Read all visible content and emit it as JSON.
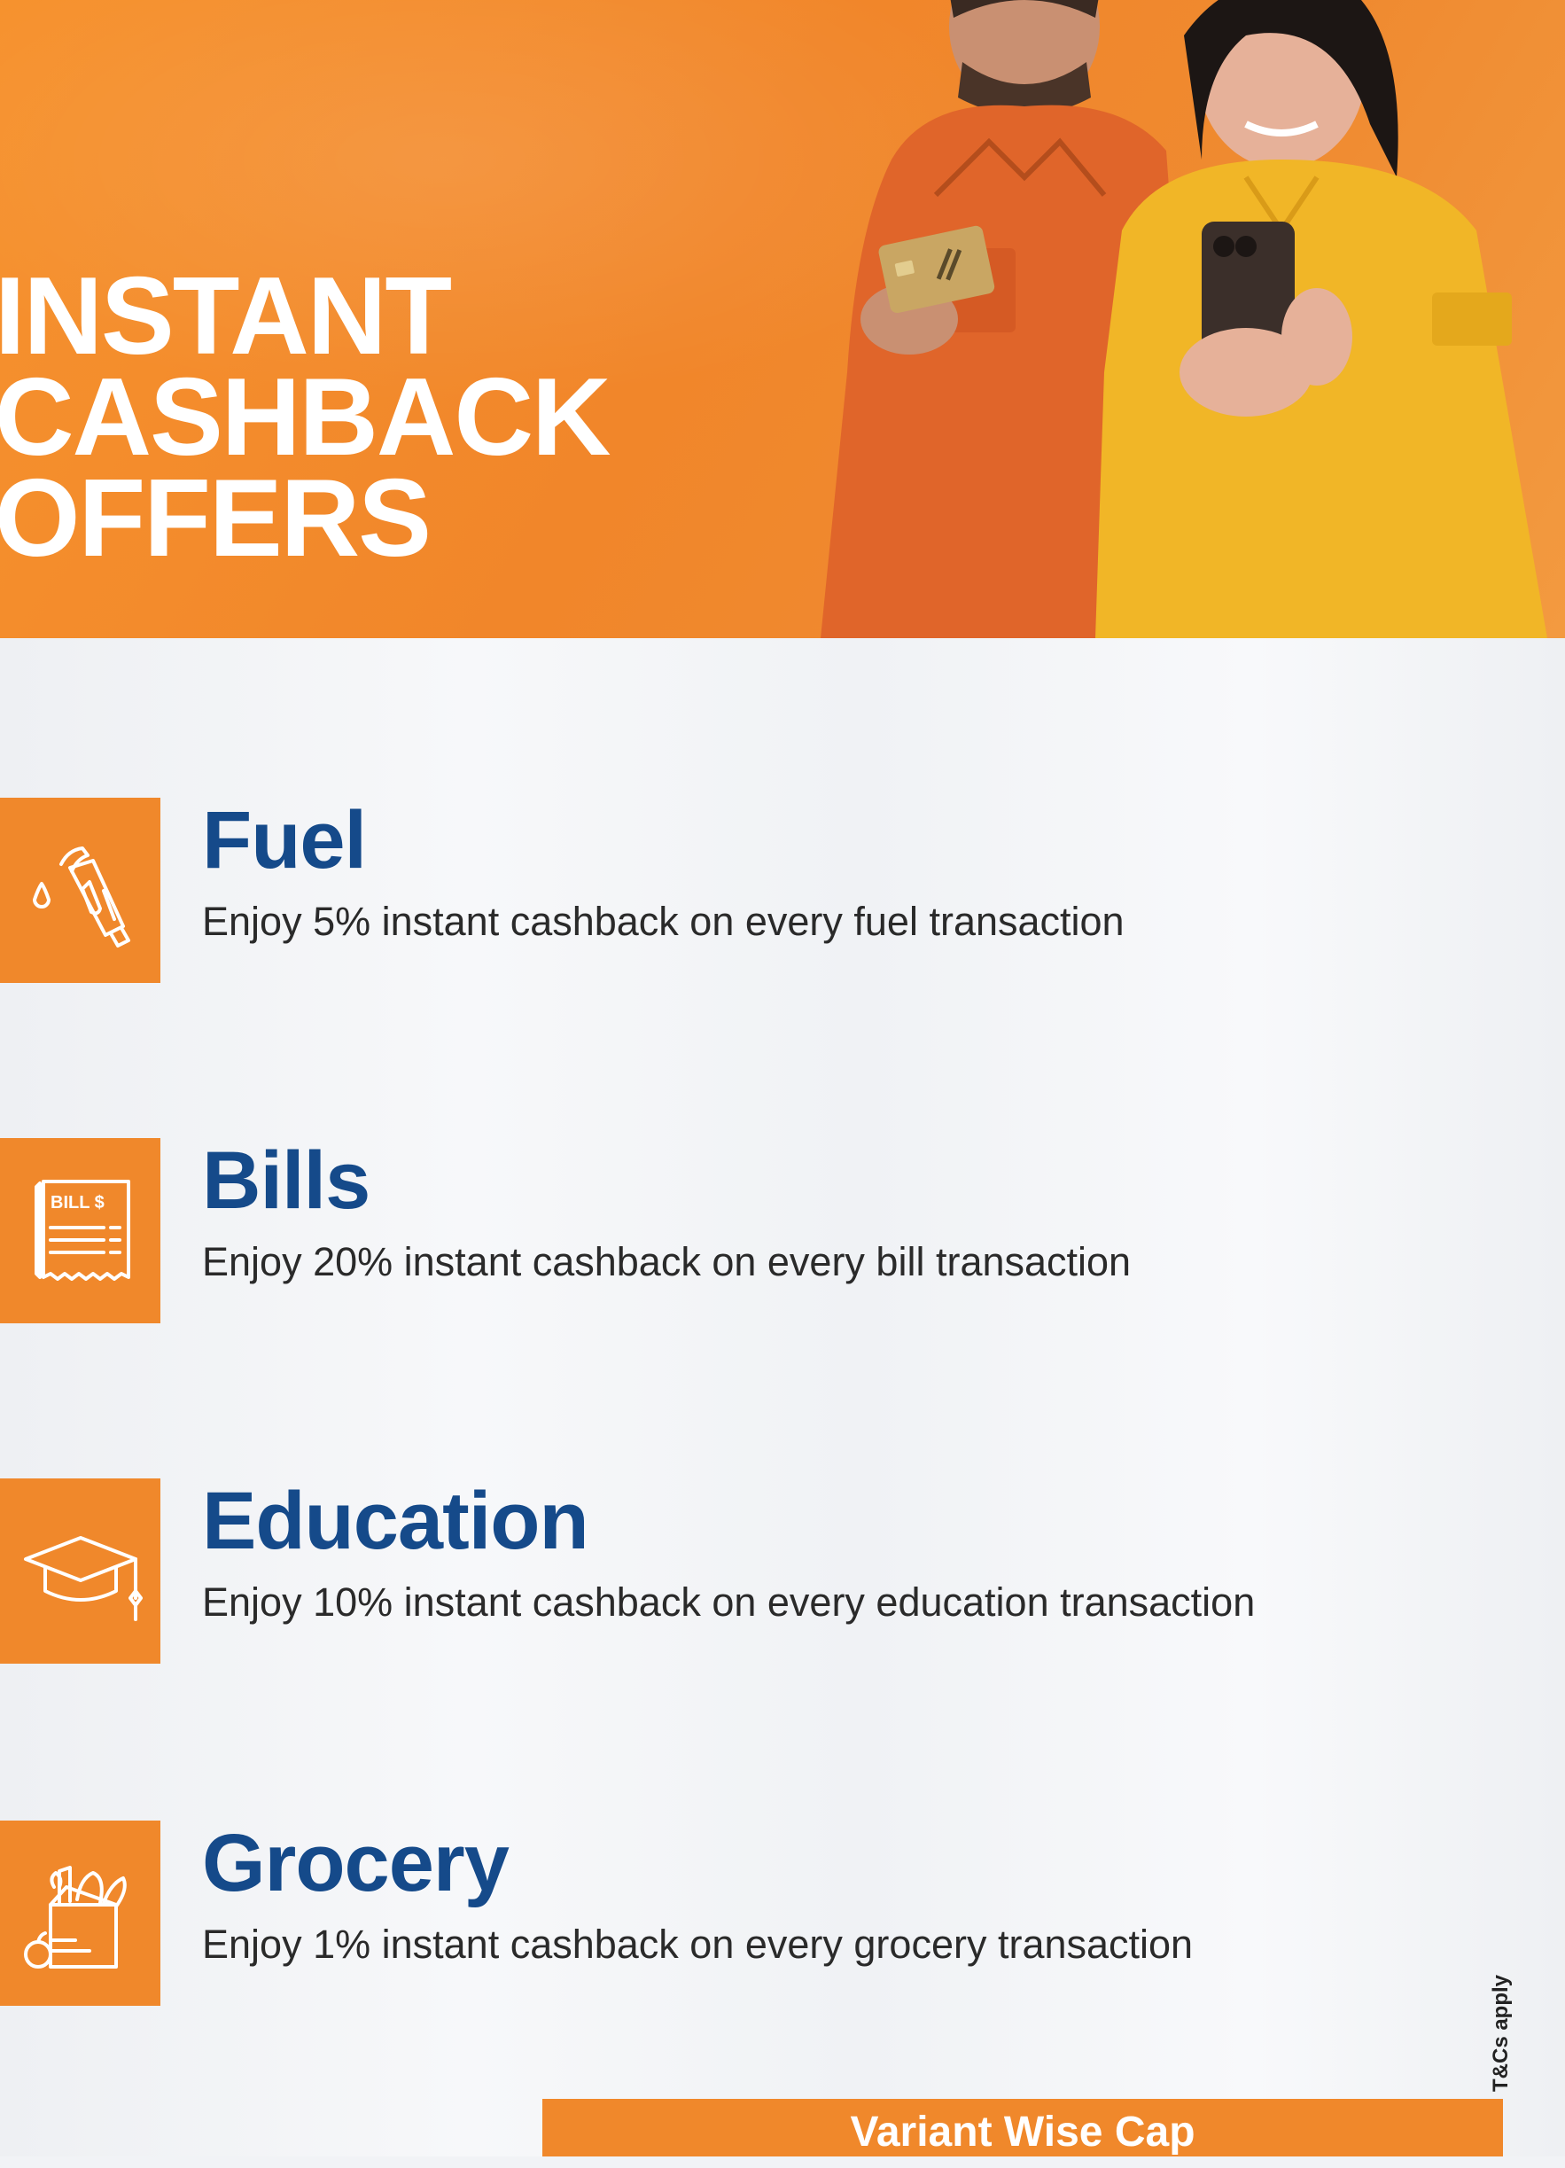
{
  "hero": {
    "title_lines": [
      "INSTANT",
      "CASHBACK",
      "OFFERS"
    ]
  },
  "offers": [
    {
      "icon": "fuel-nozzle-icon",
      "title": "Fuel",
      "description": "Enjoy 5% instant cashback on every fuel transaction"
    },
    {
      "icon": "bill-receipt-icon",
      "title": "Bills",
      "description": "Enjoy 20% instant cashback on every bill transaction",
      "icon_text": "BILL $"
    },
    {
      "icon": "graduation-cap-icon",
      "title": "Education",
      "description": "Enjoy 10% instant cashback on every education transaction"
    },
    {
      "icon": "grocery-bag-icon",
      "title": "Grocery",
      "description": "Enjoy 1% instant cashback on every grocery transaction"
    }
  ],
  "terms_note": "T&Cs apply",
  "cap_bar": {
    "label": "Variant Wise Cap"
  },
  "colors": {
    "brand_orange": "#f0882b",
    "title_blue": "#154a8a",
    "text_dark": "#2a2a2a"
  }
}
